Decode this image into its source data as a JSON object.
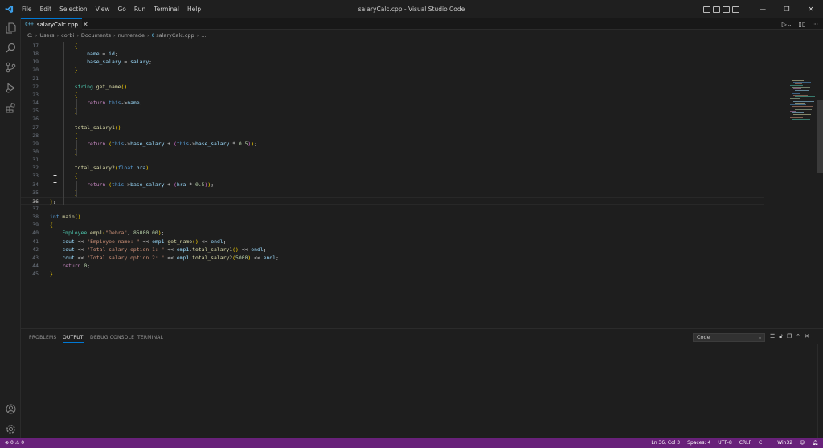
{
  "window": {
    "title": "salaryCalc.cpp - Visual Studio Code",
    "menu": [
      "File",
      "Edit",
      "Selection",
      "View",
      "Go",
      "Run",
      "Terminal",
      "Help"
    ]
  },
  "tab": {
    "badge": "C++",
    "label": "salaryCalc.cpp",
    "close": "✕"
  },
  "breadcrumb": [
    "C:",
    "Users",
    "corbi",
    "Documents",
    "numerade",
    "salaryCalc.cpp",
    "..."
  ],
  "editor": {
    "active_line": 36,
    "lines": [
      {
        "n": 17,
        "t": "        {"
      },
      {
        "n": 18,
        "t": "            name = id;"
      },
      {
        "n": 19,
        "t": "            base_salary = salary;"
      },
      {
        "n": 20,
        "t": "        }"
      },
      {
        "n": 21,
        "t": ""
      },
      {
        "n": 22,
        "t": "        string get_name()"
      },
      {
        "n": 23,
        "t": "        {"
      },
      {
        "n": 24,
        "t": "            return this->name;"
      },
      {
        "n": 25,
        "t": "        }"
      },
      {
        "n": 26,
        "t": ""
      },
      {
        "n": 27,
        "t": "        total_salary1()"
      },
      {
        "n": 28,
        "t": "        {"
      },
      {
        "n": 29,
        "t": "            return (this->base_salary + (this->base_salary * 0.5));"
      },
      {
        "n": 30,
        "t": "        }"
      },
      {
        "n": 31,
        "t": ""
      },
      {
        "n": 32,
        "t": "        total_salary2(float hra)"
      },
      {
        "n": 33,
        "t": "        {"
      },
      {
        "n": 34,
        "t": "            return (this->base_salary + (hra * 0.5));"
      },
      {
        "n": 35,
        "t": "        }"
      },
      {
        "n": 36,
        "t": "};"
      },
      {
        "n": 37,
        "t": ""
      },
      {
        "n": 38,
        "t": "int main()"
      },
      {
        "n": 39,
        "t": "{"
      },
      {
        "n": 40,
        "t": "    Employee emp1(\"Debra\", 85000.00);"
      },
      {
        "n": 41,
        "t": "    cout << \"Employee name: \" << emp1.get_name() << endl;"
      },
      {
        "n": 42,
        "t": "    cout << \"Total salary option 1: \" << emp1.total_salary1() << endl;"
      },
      {
        "n": 43,
        "t": "    cout << \"Total salary option 2: \" << emp1.total_salary2(5000) << endl;"
      },
      {
        "n": 44,
        "t": "    return 0;"
      },
      {
        "n": 45,
        "t": "}"
      }
    ]
  },
  "panel": {
    "tabs": [
      "PROBLEMS",
      "OUTPUT",
      "DEBUG CONSOLE",
      "TERMINAL"
    ],
    "active_tab": "OUTPUT",
    "output_channel": "Code"
  },
  "statusbar": {
    "errors": "0",
    "warnings": "0",
    "position": "Ln 36, Col 3",
    "spaces": "Spaces: 4",
    "encoding": "UTF-8",
    "eol": "CRLF",
    "language": "C++",
    "platform": "Win32"
  },
  "colors": {
    "statusbar": "#68217a",
    "accent": "#0078d4"
  }
}
